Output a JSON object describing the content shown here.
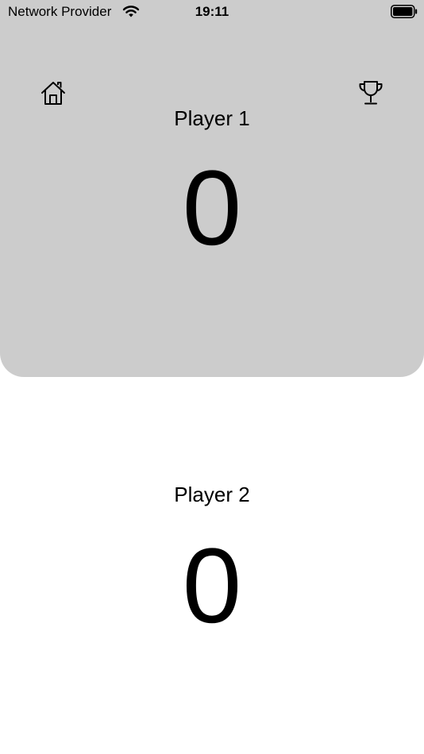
{
  "status_bar": {
    "carrier": "Network Provider",
    "time": "19:11"
  },
  "players": [
    {
      "name": "Player 1",
      "score": "0"
    },
    {
      "name": "Player 2",
      "score": "0"
    }
  ],
  "colors": {
    "player1_panel": "#cccccc",
    "player2_panel": "#ffffff",
    "text": "#000000"
  },
  "icons": {
    "home": "home-icon",
    "trophy": "trophy-icon",
    "wifi": "wifi-icon",
    "battery": "battery-icon"
  }
}
